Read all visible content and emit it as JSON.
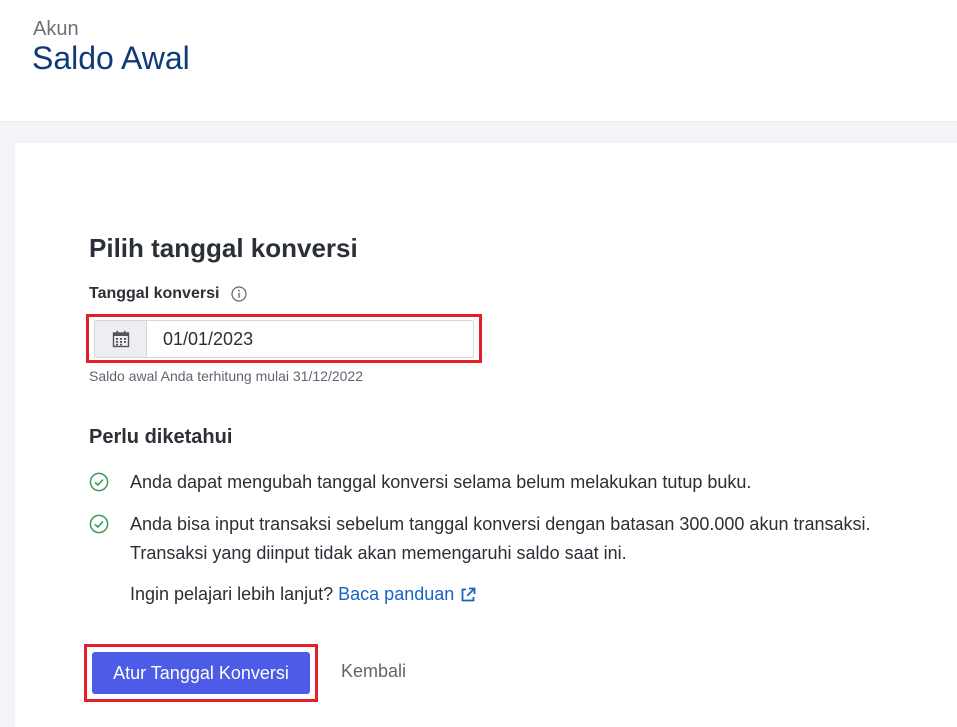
{
  "header": {
    "breadcrumb": "Akun",
    "title": "Saldo Awal"
  },
  "form": {
    "section_title": "Pilih tanggal konversi",
    "date_label": "Tanggal konversi",
    "date_value": "01/01/2023",
    "date_icon": "calendar-icon",
    "helper_text": "Saldo awal Anda terhitung mulai 31/12/2022"
  },
  "info": {
    "title": "Perlu diketahui",
    "items": [
      "Anda dapat mengubah tanggal konversi selama belum melakukan tutup buku.",
      "Anda bisa input transaksi sebelum tanggal konversi dengan batasan 300.000 akun transaksi.",
      "Transaksi yang diinput tidak akan memengaruhi saldo saat ini."
    ],
    "learn_more_text": "Ingin pelajari lebih lanjut?",
    "learn_more_link": "Baca panduan"
  },
  "actions": {
    "primary_label": "Atur Tanggal Konversi",
    "secondary_label": "Kembali"
  },
  "colors": {
    "primary": "#4c5ce6",
    "title": "#0f3a78",
    "link": "#1a62c4",
    "success": "#3c9b5a",
    "highlight": "#e3202a"
  }
}
